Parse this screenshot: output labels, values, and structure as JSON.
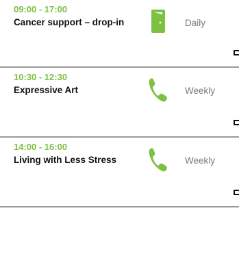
{
  "events": [
    {
      "time": "09:00 - 17:00",
      "title": "Cancer support – drop-in",
      "icon": "door-icon",
      "frequency": "Daily"
    },
    {
      "time": "10:30 - 12:30",
      "title": "Expressive Art",
      "icon": "phone-icon",
      "frequency": "Weekly"
    },
    {
      "time": "14:00 - 16:00",
      "title": "Living with Less Stress",
      "icon": "phone-icon",
      "frequency": "Weekly"
    }
  ],
  "colors": {
    "accent": "#7dc142",
    "divider": "#9a9a9a",
    "muted": "#7a7a7a"
  }
}
